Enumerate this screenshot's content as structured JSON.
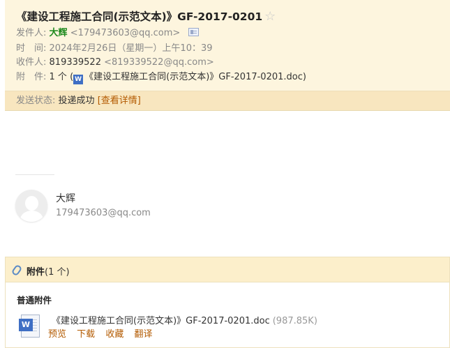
{
  "header": {
    "subject": "《建设工程施工合同(示范文本)》GF-2017-0201",
    "star_icon": "☆",
    "from_label": "发件人:",
    "from_name": "大辉",
    "from_addr": "<179473603@qq.com>",
    "time_label": "时　间:",
    "time_value": "2024年2月26日（星期一）上午10：39",
    "to_label": "收件人:",
    "to_name": "819339522",
    "to_addr": "<819339522@qq.com>",
    "attach_label": "附　件:",
    "attach_count": "1 个 (",
    "attach_icon": "W",
    "attach_name": "《建设工程施工合同(示范文本)》GF-2017-0201.doc",
    "attach_close": ")"
  },
  "status": {
    "label": "发送状态:",
    "value": "投递成功",
    "detail_link": "[查看详情]"
  },
  "signature": {
    "name": "大辉",
    "email": "179473603@qq.com"
  },
  "attachments": {
    "title": "附件",
    "count": "(1 个)",
    "group_label": "普通附件",
    "icon_letter": "W",
    "file_name": "《建设工程施工合同(示范文本)》GF-2017-0201.doc",
    "file_size": "(987.85K)",
    "actions": {
      "preview": "预览",
      "download": "下载",
      "favorite": "收藏",
      "translate": "翻译"
    }
  },
  "colors": {
    "header_bg": "#fdf5de",
    "status_bg": "#f8e6bf",
    "sender_green": "#1e8a1e",
    "link_orange": "#b35a00",
    "word_blue": "#3f6fc4"
  }
}
